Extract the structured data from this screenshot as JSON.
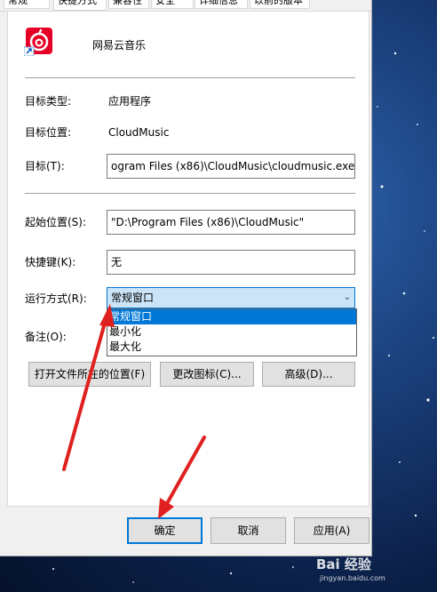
{
  "tabs": [
    "常规",
    "快捷方式",
    "兼容性",
    "安全",
    "详细信息",
    "以前的版本"
  ],
  "app_name": "网易云音乐",
  "fields": {
    "target_type_label": "目标类型:",
    "target_type_value": "应用程序",
    "target_location_label": "目标位置:",
    "target_location_value": "CloudMusic",
    "target_label": "目标(T):",
    "target_value": "ogram Files (x86)\\CloudMusic\\cloudmusic.exe\"",
    "start_in_label": "起始位置(S):",
    "start_in_value": "\"D:\\Program Files (x86)\\CloudMusic\"",
    "shortcut_key_label": "快捷键(K):",
    "shortcut_key_value": "无",
    "run_label": "运行方式(R):",
    "run_value": "常规窗口",
    "comment_label": "备注(O):"
  },
  "run_options": [
    "常规窗口",
    "最小化",
    "最大化"
  ],
  "buttons": {
    "open_location": "打开文件所在的位置(F)",
    "change_icon": "更改图标(C)...",
    "advanced": "高级(D)...",
    "ok": "确定",
    "cancel": "取消",
    "apply": "应用(A)"
  },
  "watermark": "Bai 经验",
  "watermark_url": "jingyan.baidu.com",
  "colors": {
    "accent": "#0078d7",
    "arrow": "#e0201f",
    "app_icon": "#e60026"
  }
}
